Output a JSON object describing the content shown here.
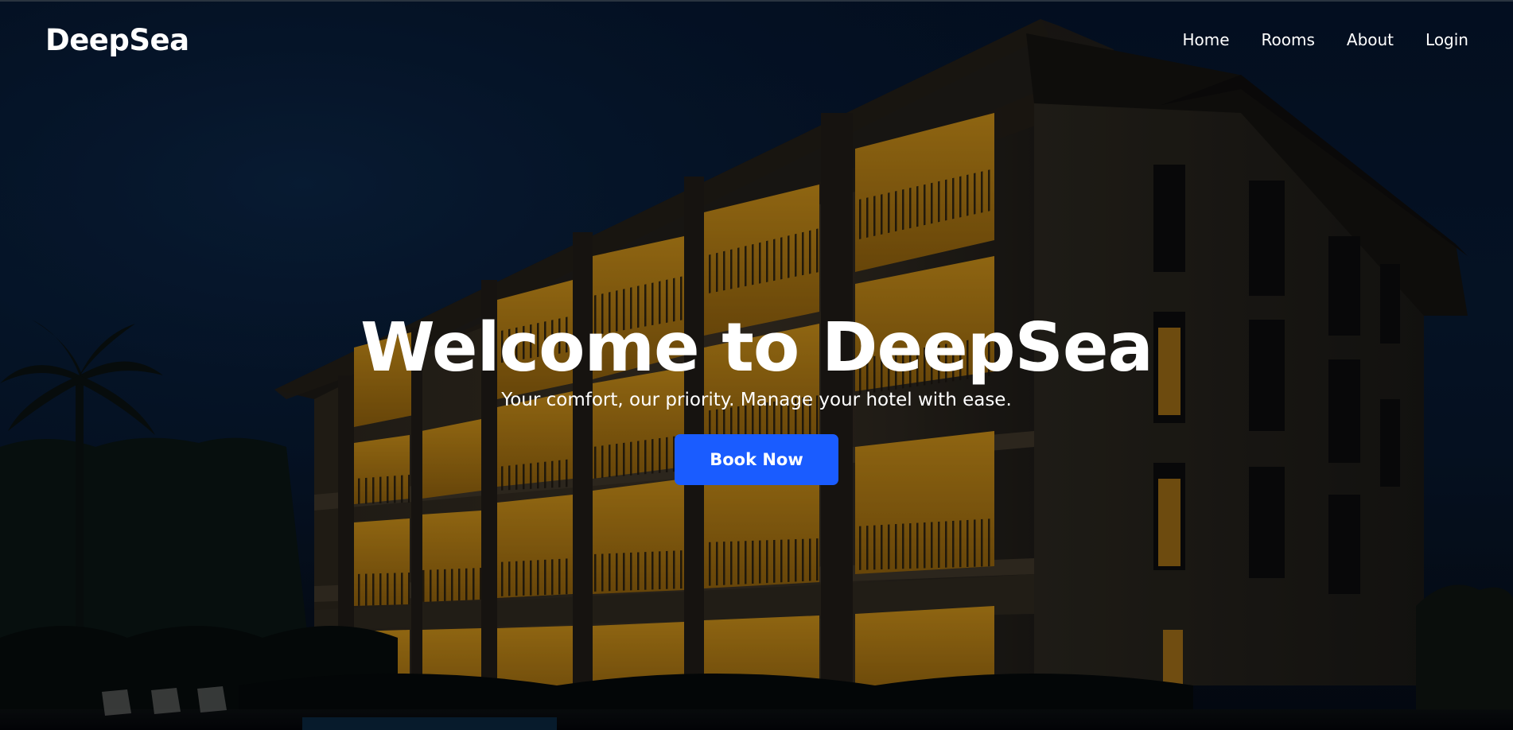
{
  "brand": {
    "name": "DeepSea"
  },
  "nav": {
    "items": [
      {
        "label": "Home"
      },
      {
        "label": "Rooms"
      },
      {
        "label": "About"
      },
      {
        "label": "Login"
      }
    ]
  },
  "hero": {
    "title": "Welcome to DeepSea",
    "subtitle": "Your comfort, our priority. Manage your hotel with ease.",
    "cta_label": "Book Now"
  },
  "colors": {
    "accent": "#1a5cff",
    "night_sky": "#051327",
    "window_light": "#d9a21a"
  }
}
